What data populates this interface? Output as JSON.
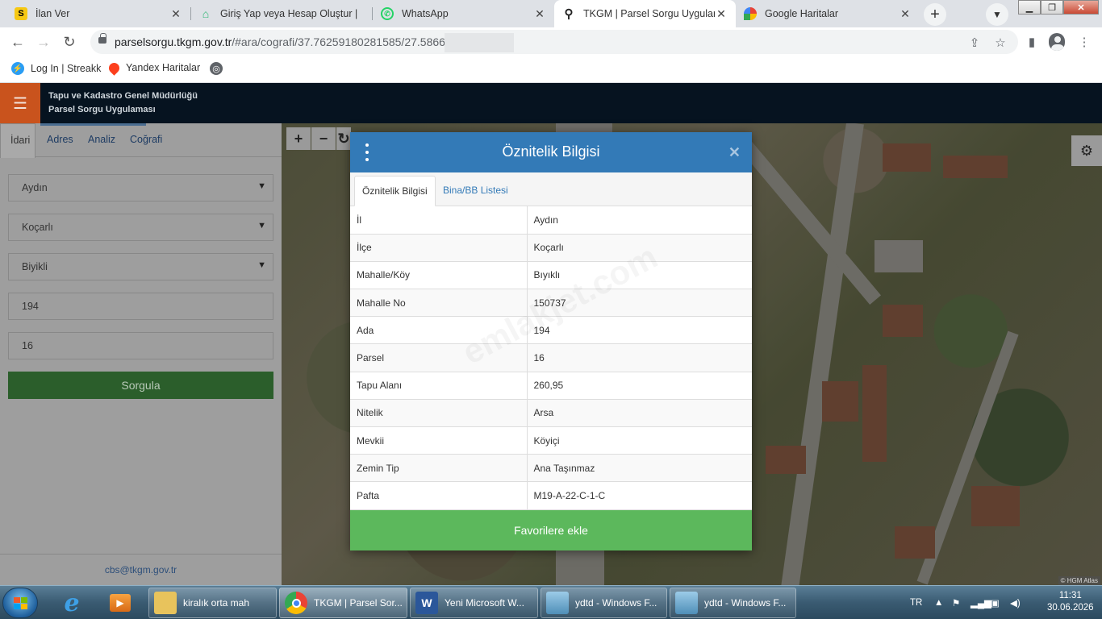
{
  "browser": {
    "tabs": [
      {
        "title": "İlan Ver",
        "icon": "s-logo-icon",
        "active": false
      },
      {
        "title": "Giriş Yap veya Hesap Oluştur |",
        "icon": "hepsiemlak-icon",
        "active": false
      },
      {
        "title": "WhatsApp",
        "icon": "whatsapp-icon",
        "active": false
      },
      {
        "title": "TKGM | Parsel Sorgu Uygulama",
        "icon": "location-pin-icon",
        "active": true
      },
      {
        "title": "Google Haritalar",
        "icon": "google-maps-icon",
        "active": false
      }
    ],
    "url_main": "parselsorgu.tkgm.gov.tr",
    "url_path": "/#ara/cografi/37.76259180281585/27.5866",
    "bookmarks": [
      {
        "label": "Log In | Streakk",
        "icon": "streakk-icon"
      },
      {
        "label": "Yandex Haritalar",
        "icon": "yandex-maps-icon"
      },
      {
        "label": "",
        "icon": "globe-icon"
      }
    ]
  },
  "app": {
    "org_line1": "Tapu ve Kadastro Genel Müdürlüğü",
    "org_line2": "Parsel Sorgu Uygulaması",
    "sidebar_tabs": [
      "İdari",
      "Adres",
      "Analiz",
      "Coğrafi"
    ],
    "fields": {
      "il": "Aydın",
      "ilce": "Koçarlı",
      "mahalle": "Biyikli",
      "ada": "194",
      "parsel": "16"
    },
    "query_button": "Sorgula",
    "footer_email": "cbs@tkgm.gov.tr",
    "map_attribution": "© HGM Atlas"
  },
  "modal": {
    "title": "Öznitelik Bilgisi",
    "tabs": [
      "Öznitelik Bilgisi",
      "Bina/BB Listesi"
    ],
    "rows": [
      {
        "key": "İl",
        "value": "Aydın"
      },
      {
        "key": "İlçe",
        "value": "Koçarlı"
      },
      {
        "key": "Mahalle/Köy",
        "value": "Bıyıklı"
      },
      {
        "key": "Mahalle No",
        "value": "150737"
      },
      {
        "key": "Ada",
        "value": "194"
      },
      {
        "key": "Parsel",
        "value": "16"
      },
      {
        "key": "Tapu Alanı",
        "value": "260,95"
      },
      {
        "key": "Nitelik",
        "value": "Arsa"
      },
      {
        "key": "Mevkii",
        "value": "Köyiçi"
      },
      {
        "key": "Zemin Tip",
        "value": "Ana Taşınmaz"
      },
      {
        "key": "Pafta",
        "value": "M19-A-22-C-1-C"
      }
    ],
    "favorites_button": "Favorilere ekle"
  },
  "taskbar": {
    "tasks": [
      {
        "label": "kiralık orta mah",
        "icon": "folder-icon"
      },
      {
        "label": "TKGM | Parsel Sor...",
        "icon": "chrome-icon"
      },
      {
        "label": "Yeni Microsoft W...",
        "icon": "word-icon"
      },
      {
        "label": "ydtd - Windows F...",
        "icon": "photo-viewer-icon"
      },
      {
        "label": "ydtd - Windows F...",
        "icon": "photo-viewer-icon"
      }
    ],
    "language": "TR",
    "time": "11:31",
    "date": "30.06.2026"
  },
  "colors": {
    "header_bg": "#061320",
    "hamburger_bg": "#c9531d",
    "modal_header": "#337ab7",
    "favorites_green": "#5cb85c",
    "query_green": "#2b5e2b"
  }
}
